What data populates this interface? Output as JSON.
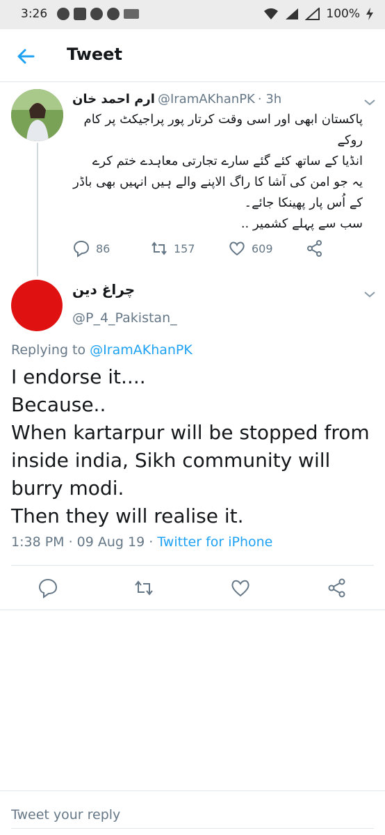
{
  "status_bar": {
    "time": "3:26",
    "battery": "100%",
    "icons": [
      "message-icon",
      "linkedin-icon",
      "chrome-icon",
      "chrome-icon",
      "amazon-icon",
      "wifi-icon",
      "signal-icon",
      "signal-icon",
      "battery-charging-icon"
    ]
  },
  "header": {
    "title": "Tweet"
  },
  "parent_tweet": {
    "name": "ارم احمد خان",
    "handle": "@IramAKhanPK",
    "time": "· 3h",
    "lines": [
      "پاکستان ابھی اور اسی وقت کرتار پور پراجیکٹ پر کام روکے",
      "انڈیا کے ساتھ کئے گئے سارے تجارتی معاہدے ختم کرے",
      "یہ جو امن کی آشا کا راگ الاپنے والے ہیں انہیں بھی باڈر کے اُس پار پھینکا جائے۔",
      "سب سے پہلے کشمیر .."
    ],
    "replies": "86",
    "retweets": "157",
    "likes": "609"
  },
  "reply_tweet": {
    "name": "چراغ دین",
    "handle": "@P_4_Pakistan_",
    "replying_prefix": "Replying to",
    "replying_to": "@IramAKhanPK",
    "lines": [
      "I endorse it....",
      "Because..",
      "When kartarpur will be stopped from",
      "inside india, Sikh community will",
      "burry modi.",
      "Then they will realise it."
    ],
    "time": "1:38 PM · 09 Aug 19 ·",
    "client": "Twitter for iPhone"
  },
  "reply_box": {
    "placeholder": "Tweet your reply"
  },
  "colors": {
    "accent": "#1da1f2",
    "muted": "#657786",
    "avatar_red": "#e01111"
  }
}
